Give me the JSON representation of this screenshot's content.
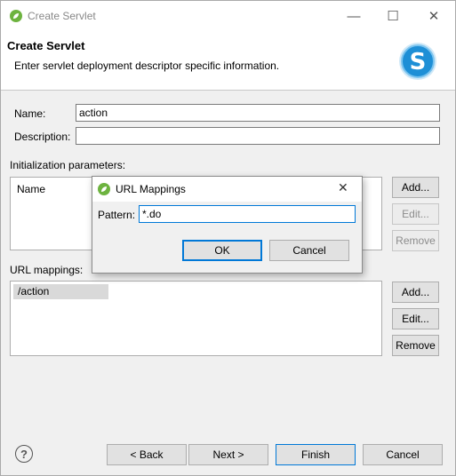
{
  "window": {
    "title": "Create Servlet",
    "minimize_glyph": "—",
    "maximize_glyph": "☐",
    "close_glyph": "✕"
  },
  "header": {
    "title": "Create Servlet",
    "description": "Enter servlet deployment descriptor specific information."
  },
  "form": {
    "name_label": "Name:",
    "name_value": "action",
    "description_label": "Description:",
    "description_value": ""
  },
  "init_params": {
    "label": "Initialization parameters:",
    "column_name": "Name",
    "add_label": "Add...",
    "edit_label": "Edit...",
    "remove_label": "Remove"
  },
  "url_mappings": {
    "label": "URL mappings:",
    "items": [
      "/action"
    ],
    "add_label": "Add...",
    "edit_label": "Edit...",
    "remove_label": "Remove"
  },
  "footer": {
    "help_glyph": "?",
    "back_label": "< Back",
    "next_label": "Next >",
    "finish_label": "Finish",
    "cancel_label": "Cancel"
  },
  "dialog": {
    "title": "URL Mappings",
    "pattern_label": "Pattern:",
    "pattern_value": "*.do",
    "ok_label": "OK",
    "cancel_label": "Cancel",
    "close_glyph": "✕"
  },
  "colors": {
    "accent": "#0078d7",
    "spring_green": "#6db33f",
    "logo_blue": "#1e8fd6"
  }
}
